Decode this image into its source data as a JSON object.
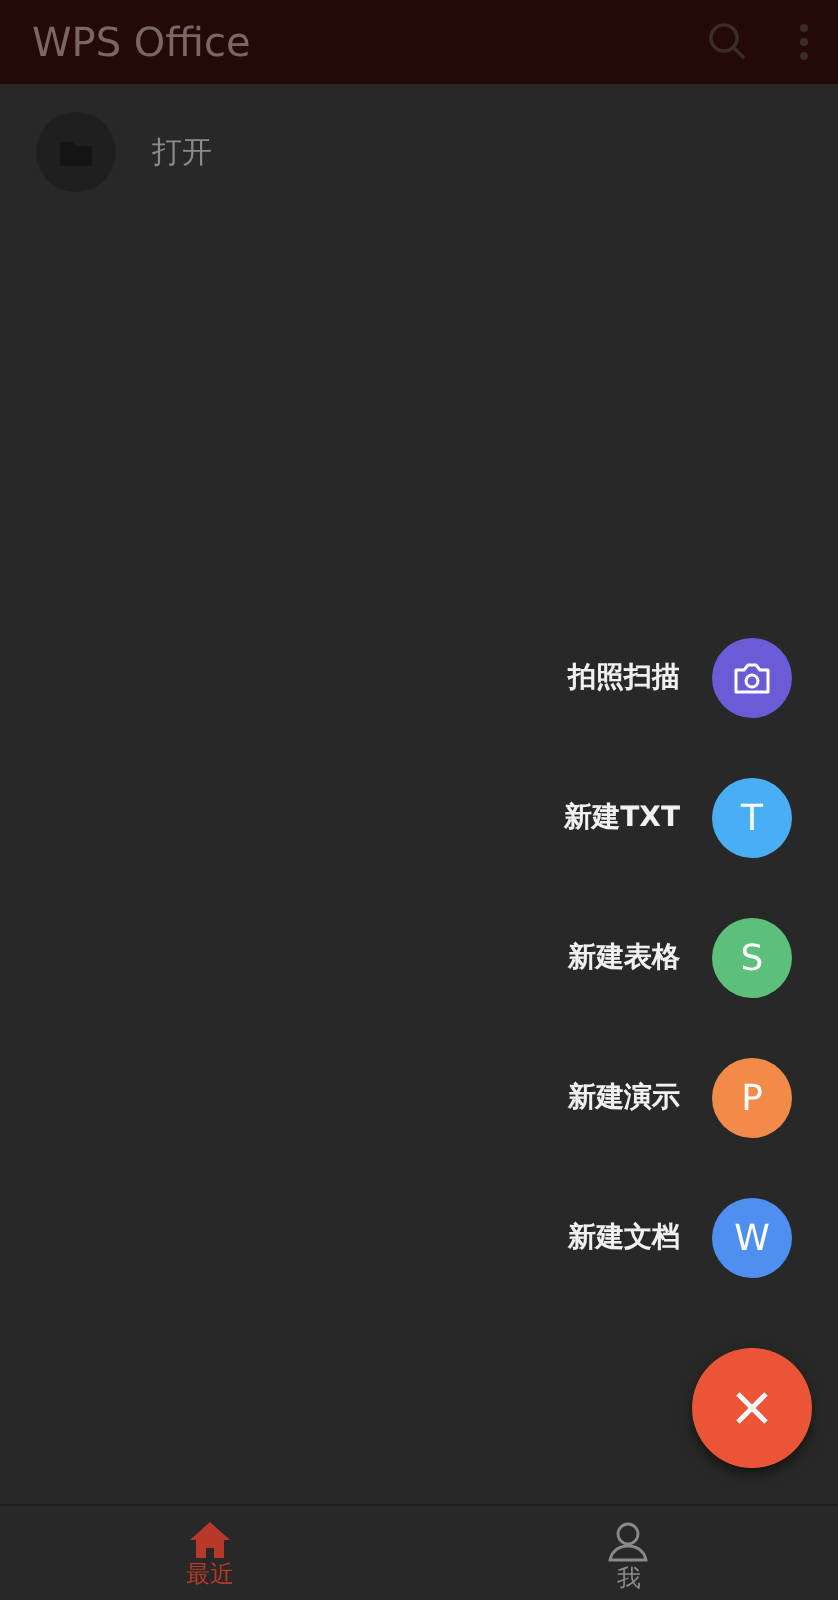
{
  "app_bar": {
    "title": "WPS Office"
  },
  "list": [
    {
      "label": "打开"
    }
  ],
  "fab_menu": [
    {
      "label": "拍照扫描",
      "kind": "camera",
      "color": "#6a5bd6"
    },
    {
      "label": "新建TXT",
      "kind": "letter",
      "glyph": "T",
      "color": "#4aaef5"
    },
    {
      "label": "新建表格",
      "kind": "letter",
      "glyph": "S",
      "color": "#5cbf7a"
    },
    {
      "label": "新建演示",
      "kind": "letter",
      "glyph": "P",
      "color": "#f28b4a"
    },
    {
      "label": "新建文档",
      "kind": "letter",
      "glyph": "W",
      "color": "#4f8ff0"
    }
  ],
  "bottom_tabs": [
    {
      "label": "最近",
      "kind": "home",
      "selected": true
    },
    {
      "label": "我",
      "kind": "person",
      "selected": false
    }
  ]
}
